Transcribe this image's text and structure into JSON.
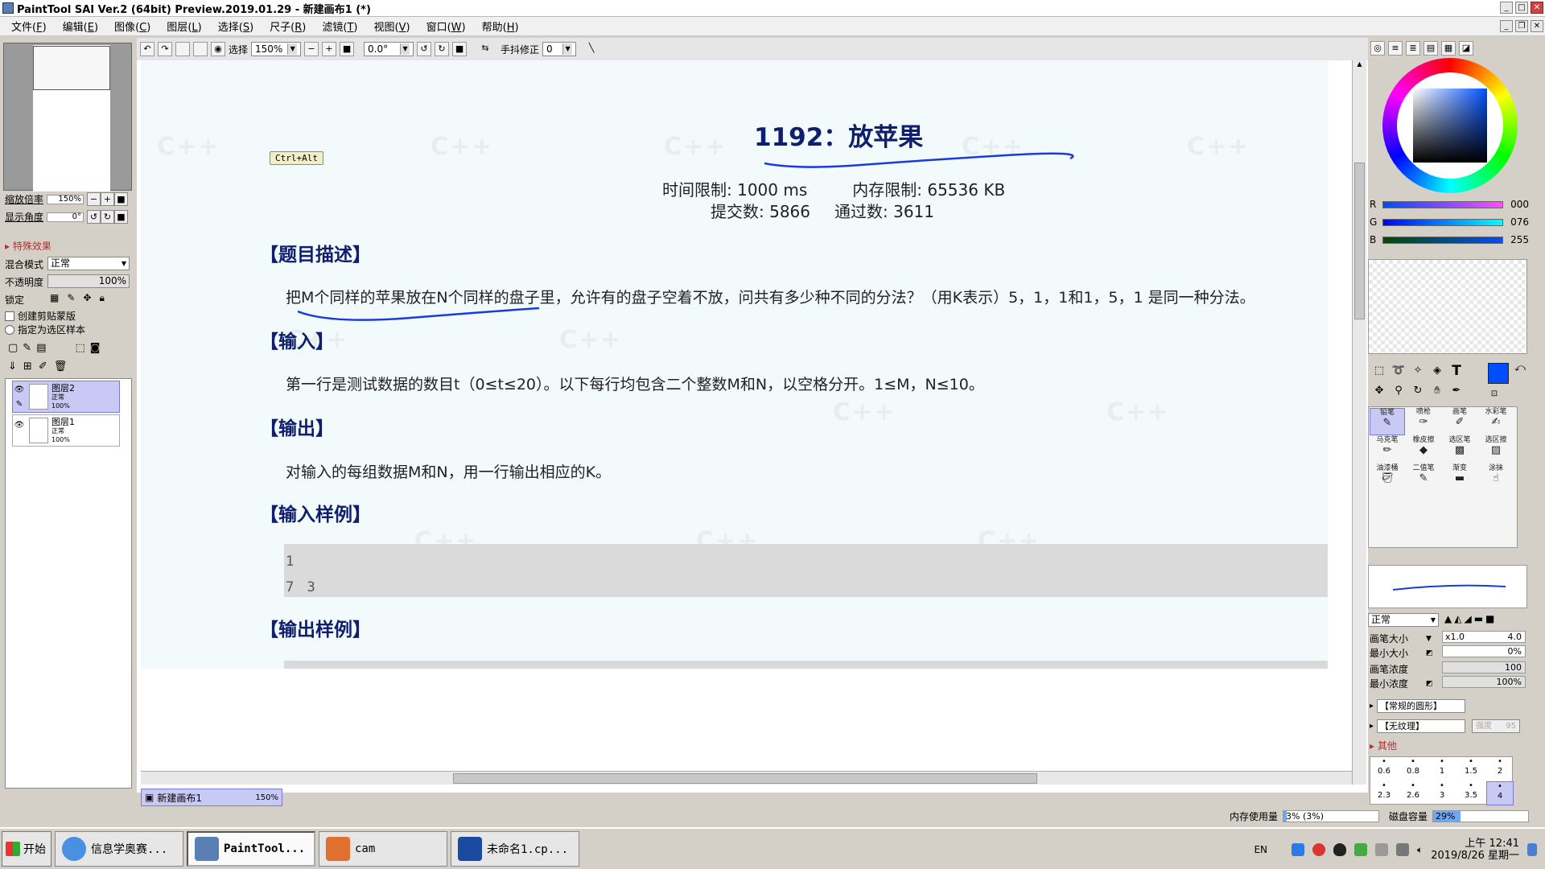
{
  "window": {
    "title": "PaintTool SAI Ver.2 (64bit) Preview.2019.01.29 - 新建画布1 (*)"
  },
  "menu": [
    {
      "label": "文件",
      "key": "F"
    },
    {
      "label": "编辑",
      "key": "E"
    },
    {
      "label": "图像",
      "key": "C"
    },
    {
      "label": "图层",
      "key": "L"
    },
    {
      "label": "选择",
      "key": "S"
    },
    {
      "label": "尺子",
      "key": "R"
    },
    {
      "label": "滤镜",
      "key": "T"
    },
    {
      "label": "视图",
      "key": "V"
    },
    {
      "label": "窗口",
      "key": "W"
    },
    {
      "label": "帮助",
      "key": "H"
    }
  ],
  "toolbar": {
    "select_label": "选择",
    "zoom": "150%",
    "rotation": "0.0°",
    "stabilizer_label": "手抖修正",
    "stabilizer_value": "0"
  },
  "left": {
    "zoom_label": "缩放倍率",
    "zoom_value": "150%",
    "angle_label": "显示角度",
    "angle_value": "0°",
    "effects_label": "特殊效果",
    "blend_label": "混合模式",
    "blend_value": "正常",
    "opacity_label": "不透明度",
    "opacity_value": "100%",
    "opacity_pct": 100,
    "lock_label": "锁定",
    "clip_label": "创建剪贴蒙版",
    "sample_label": "指定为选区样本",
    "layers": [
      {
        "name": "图层2",
        "mode": "正常",
        "opacity": "100%",
        "selected": true
      },
      {
        "name": "图层1",
        "mode": "正常",
        "opacity": "100%",
        "selected": false
      }
    ]
  },
  "document": {
    "tab_name": "新建画布1",
    "tab_zoom": "150%",
    "ctrl_hint": "Ctrl+Alt",
    "title": "1192：放苹果",
    "time_limit": "时间限制: 1000 ms",
    "mem_limit": "内存限制: 65536 KB",
    "submits": "提交数: 5866",
    "passes": "通过数: 3611",
    "h_desc": "【题目描述】",
    "desc": "把M个同样的苹果放在N个同样的盘子里，允许有的盘子空着不放，问共有多少种不同的分法？（用K表示）5，1，1和1，5，1 是同一种分法。",
    "h_input": "【输入】",
    "input": "第一行是测试数据的数目t（0≤t≤20）。以下每行均包含二个整数M和N，以空格分开。1≤M，N≤10。",
    "h_output": "【输出】",
    "output": "对输入的每组数据M和N，用一行输出相应的K。",
    "h_sample_in": "【输入样例】",
    "sample_in": [
      "1",
      "7 3"
    ],
    "h_sample_out": "【输出样例】",
    "watermark": "C++"
  },
  "right": {
    "r_label": "R",
    "r_value": "000",
    "g_label": "G",
    "g_value": "076",
    "b_label": "B",
    "b_value": "255",
    "current_color": "#004cff",
    "brushes": [
      {
        "name": "铅笔",
        "sel": true
      },
      {
        "name": "喷枪"
      },
      {
        "name": "画笔"
      },
      {
        "name": "水彩笔"
      },
      {
        "name": "马克笔"
      },
      {
        "name": "橡皮擦"
      },
      {
        "name": "选区笔"
      },
      {
        "name": "选区擦"
      },
      {
        "name": "油漆桶"
      },
      {
        "name": "二值笔"
      },
      {
        "name": "渐变"
      },
      {
        "name": "涂抹"
      }
    ],
    "mode": "正常",
    "size_label": "画笔大小",
    "size_mult": "x1.0",
    "size_value": "4.0",
    "min_size_label": "最小大小",
    "min_size_value": "0%",
    "density_label": "画笔浓度",
    "density_value": "100",
    "min_density_label": "最小浓度",
    "min_density_value": "100%",
    "shape_label": "【常规的圆形】",
    "texture_label": "【无纹理】",
    "texture_value": "强度",
    "texture_strength": "95",
    "other_label": "其他",
    "sizes": [
      "0.6",
      "0.8",
      "1",
      "1.5",
      "2",
      "2.3",
      "2.6",
      "3",
      "3.5",
      "4"
    ]
  },
  "status": {
    "mem_label": "内存使用量",
    "mem_value": "3% (3%)",
    "mem_pct": 3,
    "disk_label": "磁盘容量",
    "disk_value": "29%",
    "disk_pct": 29
  },
  "taskbar": {
    "start": "开始",
    "tasks": [
      {
        "label": "信息学奥赛...",
        "color": "#4a90e2"
      },
      {
        "label": "PaintTool...",
        "color": "#5a7fb5",
        "active": true
      },
      {
        "label": "cam",
        "color": "#e07030"
      },
      {
        "label": "未命名1.cp...",
        "color": "#1a4aa0"
      }
    ],
    "lang": "EN",
    "time": "上午 12:41",
    "date": "2019/8/26 星期一"
  }
}
